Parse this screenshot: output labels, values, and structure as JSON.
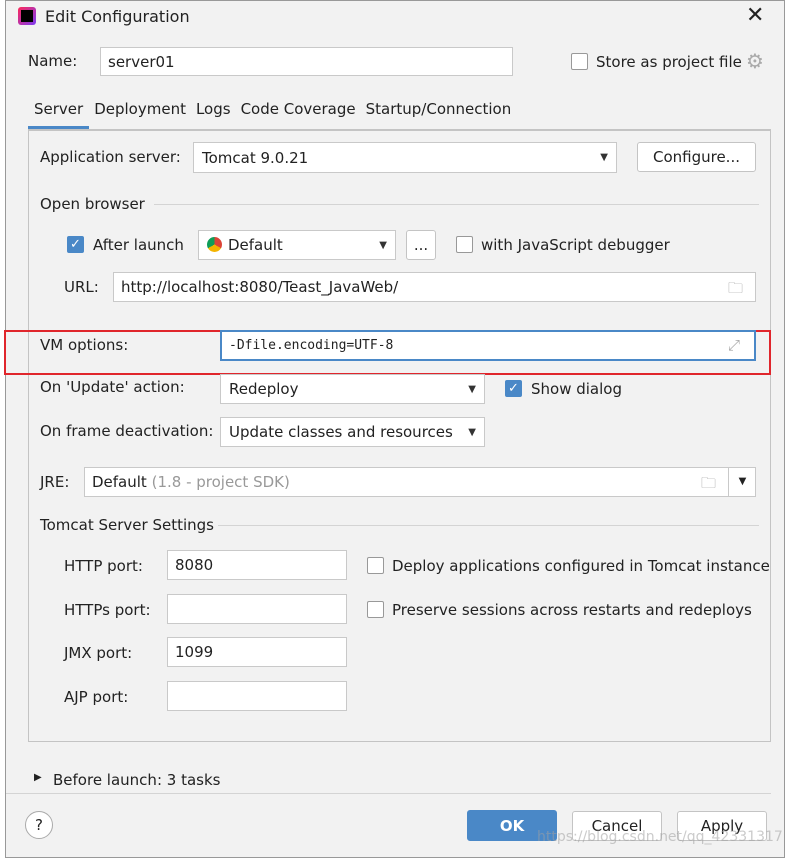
{
  "window": {
    "title": "Edit Configuration",
    "close_icon": "close-icon"
  },
  "name": {
    "label": "Name:",
    "value": "server01",
    "store_label": "Store as project file"
  },
  "tabs": [
    {
      "label": "Server",
      "active": true
    },
    {
      "label": "Deployment"
    },
    {
      "label": "Logs"
    },
    {
      "label": "Code Coverage"
    },
    {
      "label": "Startup/Connection"
    }
  ],
  "server": {
    "app_server_label": "Application server:",
    "app_server_value": "Tomcat 9.0.21",
    "configure_label": "Configure...",
    "open_browser": "Open browser",
    "after_launch_label": "After launch",
    "after_launch_checked": true,
    "browser_value": "Default",
    "ellipsis": "...",
    "js_debugger_label": "with JavaScript debugger",
    "js_debugger_checked": false,
    "url_label": "URL:",
    "url_value": "http://localhost:8080/Teast_JavaWeb/",
    "vm_label": "VM options:",
    "vm_value": "-Dfile.encoding=UTF-8",
    "update_label": "On 'Update' action:",
    "update_value": "Redeploy",
    "show_dialog_label": "Show dialog",
    "show_dialog_checked": true,
    "frame_label": "On frame deactivation:",
    "frame_value": "Update classes and resources",
    "jre_label": "JRE:",
    "jre_value": "Default",
    "jre_hint": "(1.8 - project SDK)",
    "tomcat_settings": "Tomcat Server Settings",
    "http_label": "HTTP port:",
    "http_value": "8080",
    "https_label": "HTTPs port:",
    "https_value": "",
    "jmx_label": "JMX port:",
    "jmx_value": "1099",
    "ajp_label": "AJP port:",
    "ajp_value": "",
    "deploy_label": "Deploy applications configured in Tomcat instance",
    "preserve_label": "Preserve sessions across restarts and redeploys"
  },
  "before_launch": "Before launch: 3 tasks",
  "footer": {
    "help": "?",
    "ok": "OK",
    "cancel": "Cancel",
    "apply": "Apply"
  },
  "watermark": "https://blog.csdn.net/qq_42331317",
  "colors": {
    "accent": "#4a88c7",
    "highlight": "#e0262c"
  }
}
